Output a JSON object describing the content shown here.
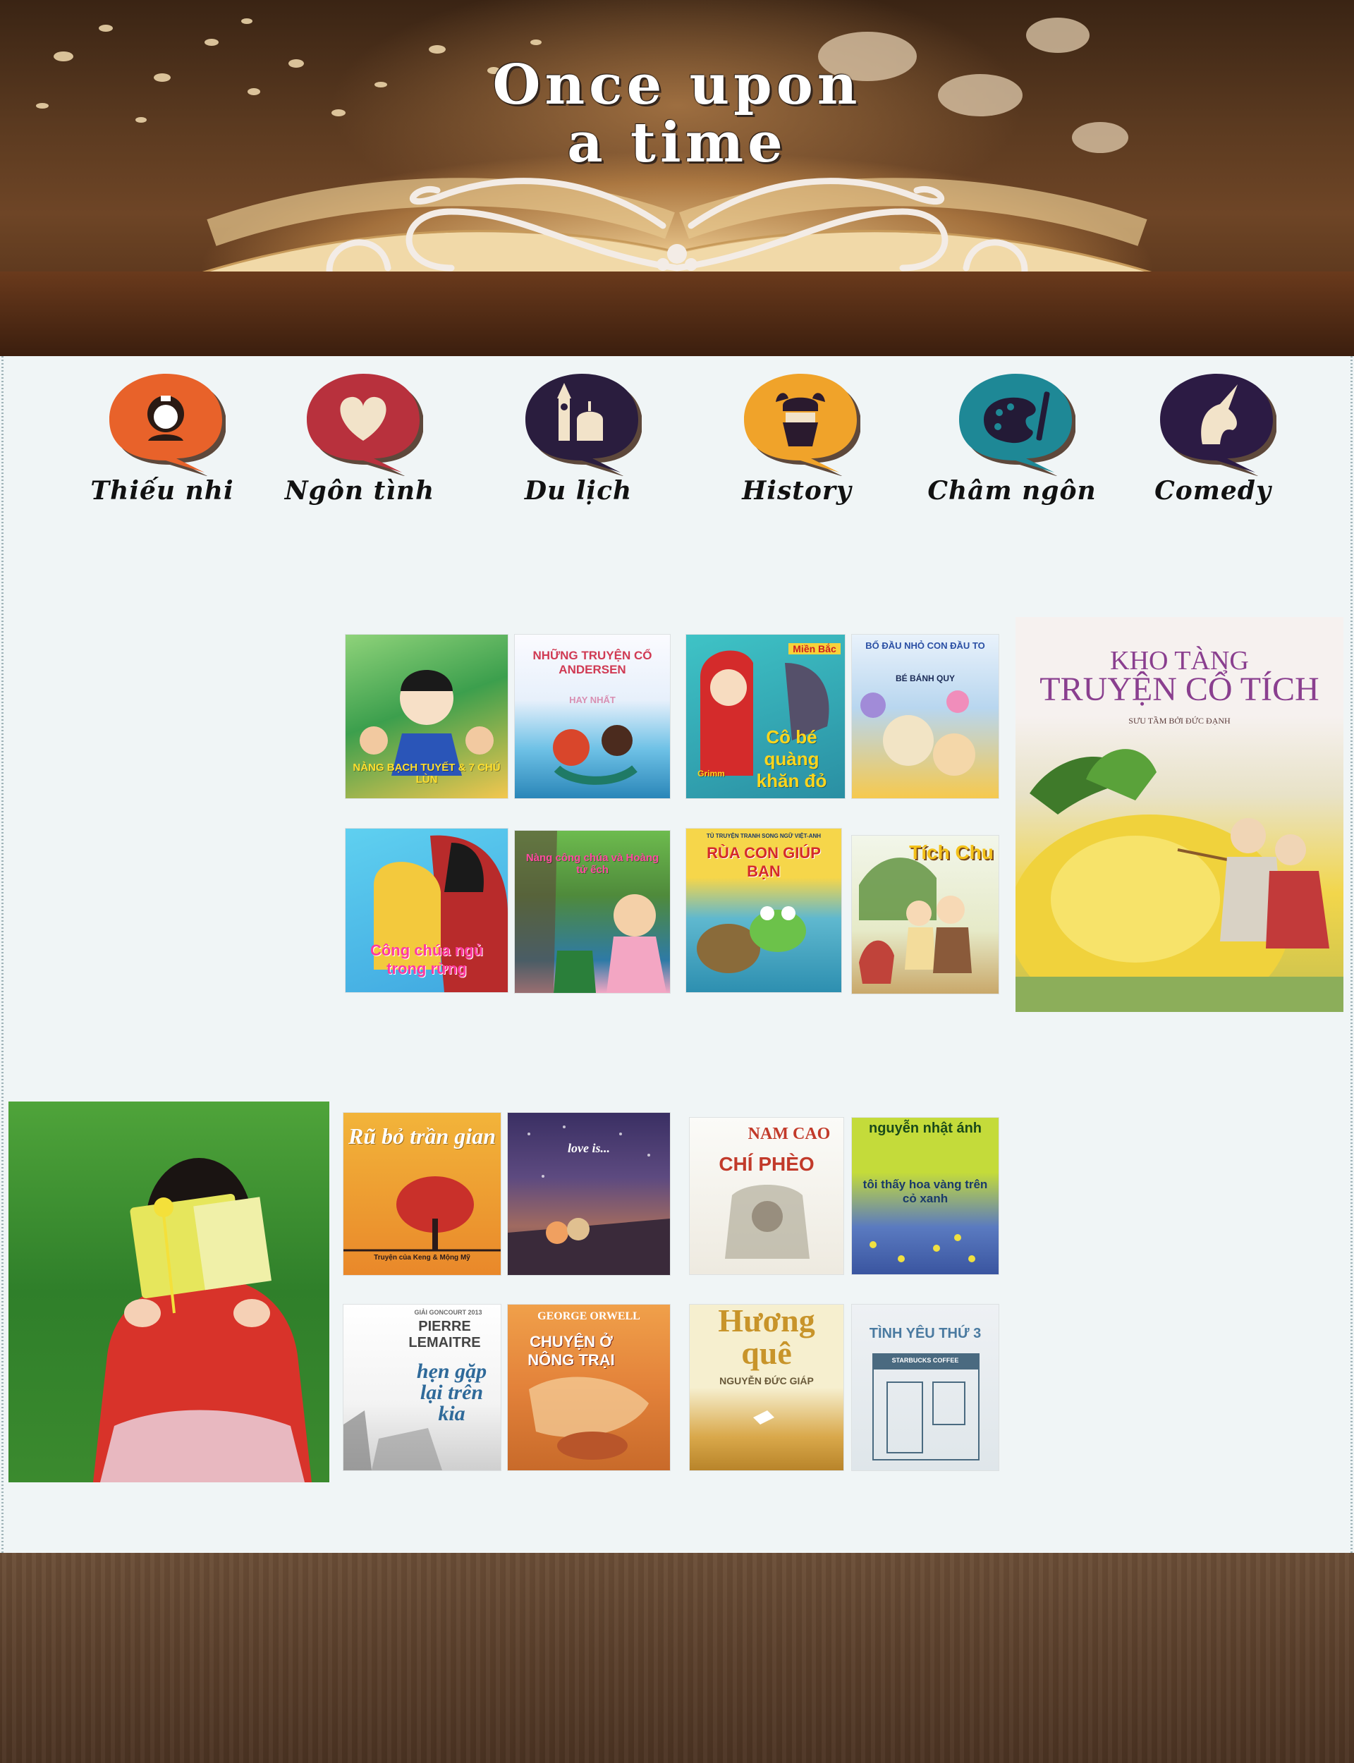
{
  "header": {
    "title_line1": "Once upon",
    "title_line2": "a time"
  },
  "categories": [
    {
      "label": "Thiếu nhi",
      "icon": "princess-icon",
      "color": "#e8622a"
    },
    {
      "label": "Ngôn tình",
      "icon": "heart-icon",
      "color": "#b8313d"
    },
    {
      "label": "Du lịch",
      "icon": "landmark-icon",
      "color": "#2a1d3e"
    },
    {
      "label": "History",
      "icon": "viking-icon",
      "color": "#f0a32a"
    },
    {
      "label": "Châm ngôn",
      "icon": "palette-icon",
      "color": "#1e8896"
    },
    {
      "label": "Comedy",
      "icon": "unicorn-icon",
      "color": "#2c1b44"
    }
  ],
  "children_books": [
    {
      "title": "NÀNG BẠCH TUYẾT & 7 CHÚ LÙN"
    },
    {
      "title": "NHỮNG TRUYỆN CỔ ANDERSEN",
      "subtitle": "HAY NHẤT"
    },
    {
      "title": "Cô bé quàng khăn đỏ",
      "badge": "Miền Bắc",
      "publisher": "Grimm"
    },
    {
      "title": "BỐ ĐẦU NHỎ CON ĐẦU TO",
      "subtitle": "BÉ BÁNH QUY"
    },
    {
      "title": "Công chúa ngủ trong rừng"
    },
    {
      "title": "Nàng công chúa và Hoàng tử ếch"
    },
    {
      "title": "RÙA CON GIÚP BẠN",
      "subtitle": "TỦ TRUYỆN TRANH SONG NGỮ VIỆT-ANH"
    },
    {
      "title": "Tích Chu"
    }
  ],
  "children_feature": {
    "title_line1": "KHO TÀNG",
    "title_line2": "TRUYỆN CỔ TÍCH",
    "subtitle": "SƯU TẦM BỞI ĐỨC ĐẠNH"
  },
  "romance_books": [
    {
      "title": "Rũ bỏ trần gian",
      "subtitle": "Truyện của Keng & Mộng Mỹ"
    },
    {
      "title": "love is..."
    },
    {
      "title": "CHÍ PHÈO",
      "author": "NAM CAO"
    },
    {
      "title": "tôi thấy hoa vàng trên cỏ xanh",
      "author": "nguyễn nhật ánh"
    },
    {
      "title": "hẹn gặp lại trên kia",
      "author": "PIERRE LEMAITRE",
      "award": "GIẢI GONCOURT 2013"
    },
    {
      "title": "CHUYỆN Ở NÔNG TRẠI",
      "author": "GEORGE ORWELL"
    },
    {
      "title": "Hương quê",
      "author": "NGUYỄN ĐỨC GIÁP"
    },
    {
      "title": "TÌNH YÊU THỨ 3",
      "subtitle": "STARBUCKS COFFEE"
    }
  ]
}
